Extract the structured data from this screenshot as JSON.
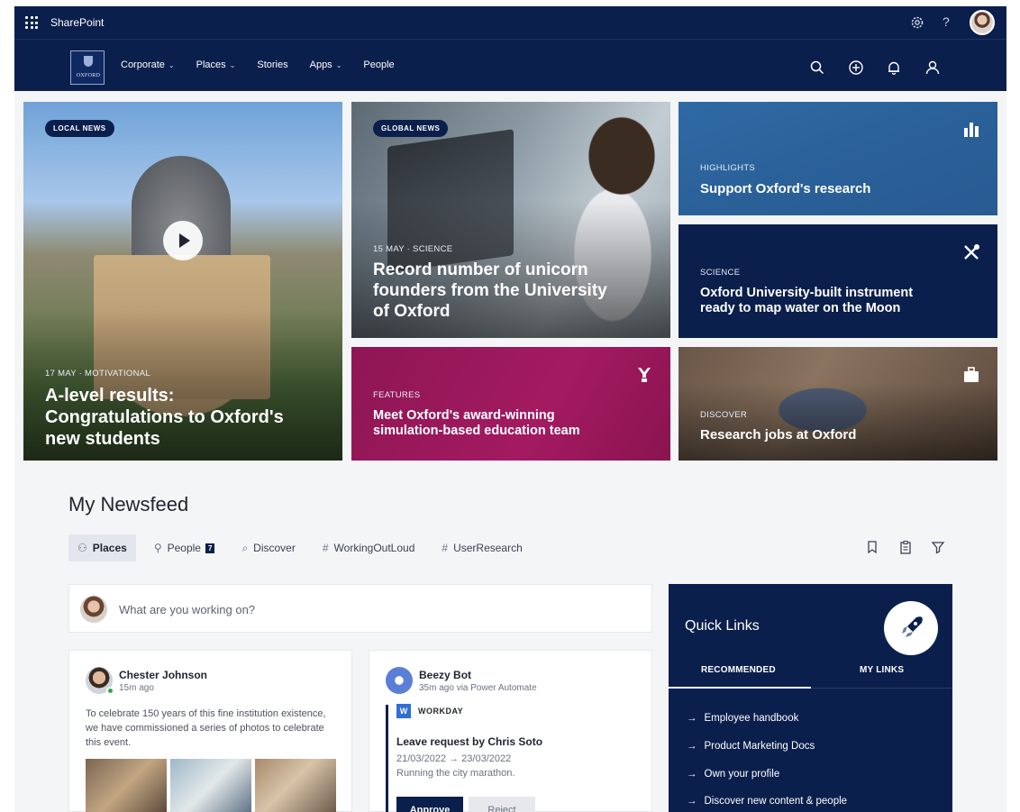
{
  "suite_bar": {
    "app_name": "SharePoint",
    "help_label": "?"
  },
  "site_nav": {
    "crest_text": "OXFORD",
    "links": [
      {
        "label": "Corporate",
        "has_dropdown": true
      },
      {
        "label": "Places",
        "has_dropdown": true
      },
      {
        "label": "Stories",
        "has_dropdown": false
      },
      {
        "label": "Apps",
        "has_dropdown": true
      },
      {
        "label": "People",
        "has_dropdown": false
      }
    ],
    "icons": [
      "search-icon",
      "add-icon",
      "bell-icon",
      "person-icon"
    ]
  },
  "hero": {
    "local": {
      "pill": "LOCAL NEWS",
      "meta": "17 MAY · MOTIVATIONAL",
      "headline_line1": "A-level results:",
      "headline_line2": "Congratulations to Oxford's",
      "headline_line3": "new students"
    },
    "global": {
      "pill": "GLOBAL NEWS",
      "meta": "15 MAY · SCIENCE",
      "headline_line1": "Record number of unicorn",
      "headline_line2": "founders from the University",
      "headline_line3": "of Oxford"
    },
    "highlights": {
      "category": "HIGHLIGHTS",
      "headline": "Support Oxford's research"
    },
    "science": {
      "category": "SCIENCE",
      "headline_line1": "Oxford University-built instrument",
      "headline_line2": "ready to map water on the Moon"
    },
    "features": {
      "category": "FEATURES",
      "headline_line1": "Meet Oxford's award-winning",
      "headline_line2": "simulation-based education team"
    },
    "discover": {
      "category": "DISCOVER",
      "headline": "Research jobs at Oxford"
    }
  },
  "newsfeed": {
    "title": "My Newsfeed",
    "tabs": [
      {
        "label": "Places",
        "active": true
      },
      {
        "label": "People",
        "badge": "7"
      },
      {
        "label": "Discover"
      },
      {
        "label": "WorkingOutLoud"
      },
      {
        "label": "UserResearch"
      }
    ],
    "composer_placeholder": "What are you working on?",
    "posts": [
      {
        "author": "Chester Johnson",
        "time": "15m ago",
        "body": "To celebrate 150 years of this fine institution existence, we have commissioned a series of photos to celebrate this event."
      },
      {
        "author": "Beezy Bot",
        "time": "35m ago via Power Automate",
        "source": "WORKDAY",
        "title": "Leave request by Chris Soto",
        "dates": "21/03/2022 → 23/03/2022",
        "reason": "Running the city marathon.",
        "approve_label": "Approve",
        "reject_label": "Reject"
      }
    ]
  },
  "quick_links": {
    "title": "Quick Links",
    "tabs": [
      "RECOMMENDED",
      "MY LINKS"
    ],
    "links": [
      "Employee handbook",
      "Product Marketing Docs",
      "Own your profile",
      "Discover new content & people"
    ]
  },
  "colors": {
    "navy": "#0b1f4d",
    "magenta": "#a31a61",
    "blue": "#2f6aa5",
    "page_bg": "#f4f5f7"
  }
}
